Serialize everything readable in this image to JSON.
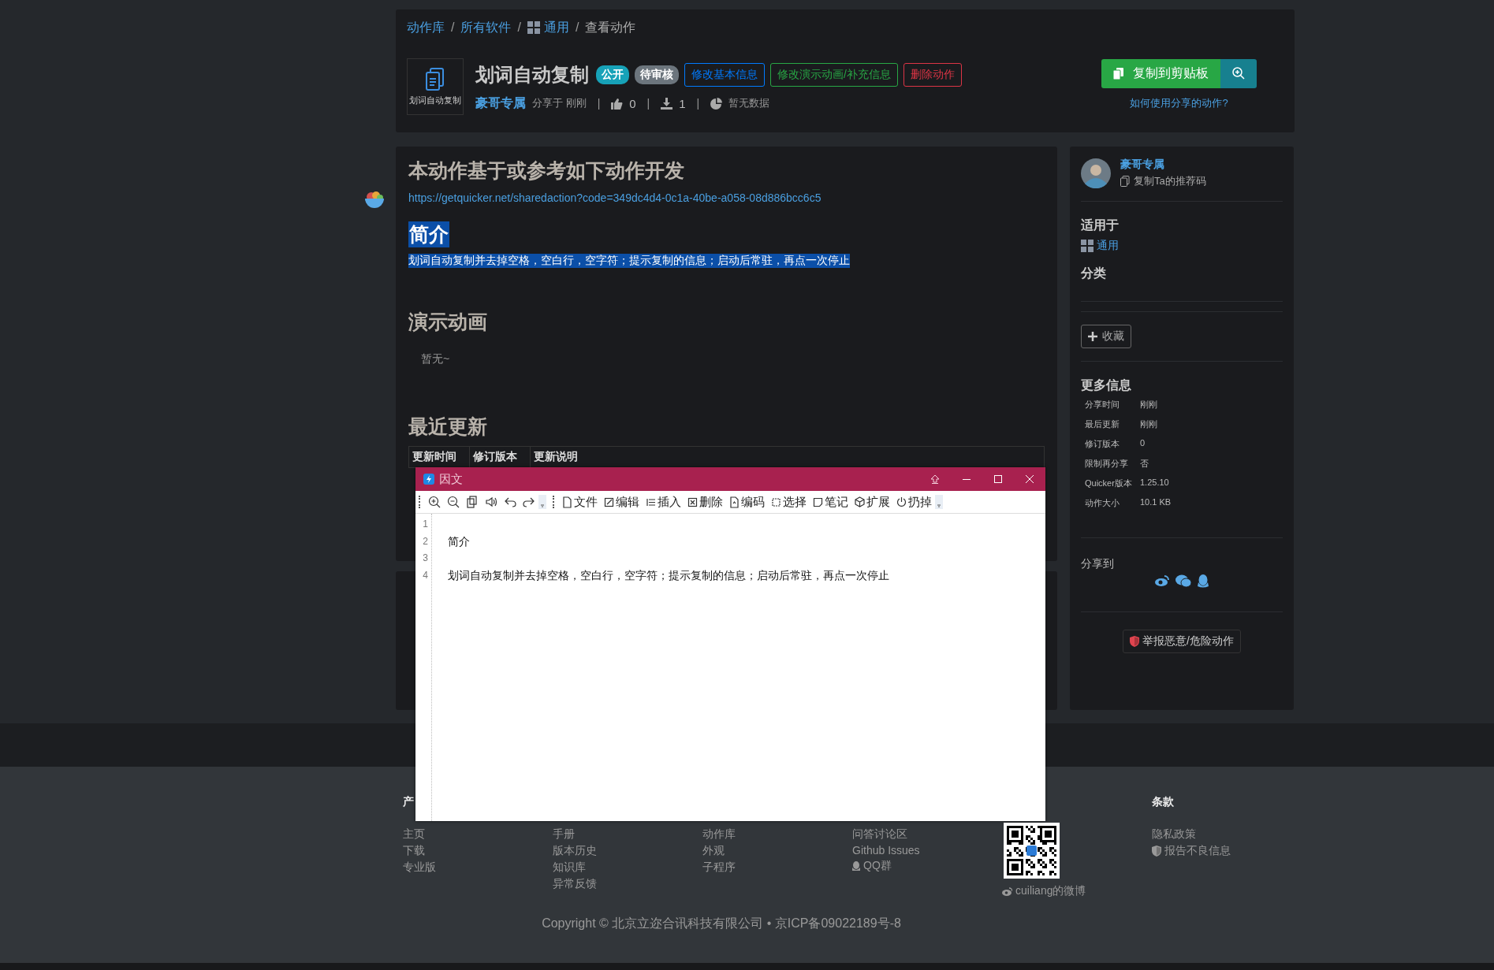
{
  "breadcrumb": [
    {
      "label": "动作库",
      "kind": "link"
    },
    {
      "label": "/",
      "kind": "separator"
    },
    {
      "label": "所有软件",
      "kind": "link"
    },
    {
      "label": "/",
      "kind": "separator"
    },
    {
      "label": "通用",
      "kind": "app"
    },
    {
      "label": "/",
      "kind": "separator"
    },
    {
      "label": "查看动作",
      "kind": "current"
    }
  ],
  "header": {
    "icon_caption": "划词自动复制",
    "title": "划词自动复制",
    "badges": [
      {
        "label": "公开",
        "color": "#17a2b8"
      },
      {
        "label": "待审核",
        "color": "#6c757d"
      }
    ],
    "actions": [
      {
        "label": "修改基本信息",
        "color": "#007bff"
      },
      {
        "label": "修改演示动画/补充信息",
        "color": "#28a745"
      },
      {
        "label": "删除动作",
        "color": "#dc3545"
      }
    ],
    "author": "豪哥专属",
    "shared": "分享于 刚刚",
    "dividers": [
      "|",
      "|",
      "|"
    ],
    "likes": "0",
    "downloads": "1",
    "stats": "暂无数据",
    "copy_button": "复制到剪贴板",
    "help_link": "如何使用分享的动作?"
  },
  "main": {
    "based_on": {
      "heading": "本动作基于或参考如下动作开发",
      "url": "https://getquicker.net/sharedaction?code=349dc4d4-0c1a-40be-a058-08d886bcc6c5"
    },
    "intro": {
      "heading": "简介",
      "text": "划词自动复制并去掉空格，空白行，空字符；提示复制的信息；启动后常驻，再点一次停止",
      "selected": true
    },
    "demo": {
      "heading": "演示动画",
      "empty": "暂无~"
    },
    "updates": {
      "heading": "最近更新",
      "columns": [
        "更新时间",
        "修订版本",
        "更新说明"
      ]
    }
  },
  "sidebar": {
    "user": {
      "name": "豪哥专属",
      "action": "复制Ta的推荐码"
    },
    "applies_to": {
      "heading": "适用于",
      "app": "通用"
    },
    "category": {
      "heading": "分类"
    },
    "favorite_button": "收藏",
    "more_info": {
      "heading": "更多信息",
      "rows": [
        {
          "label": "分享时间",
          "value": "刚刚"
        },
        {
          "label": "最后更新",
          "value": "刚刚"
        },
        {
          "label": "修订版本",
          "value": "0"
        },
        {
          "label": "限制再分享",
          "value": "否"
        },
        {
          "label": "Quicker版本",
          "value": "1.25.10"
        },
        {
          "label": "动作大小",
          "value": "10.1 KB"
        }
      ]
    },
    "share": {
      "heading": "分享到"
    },
    "report_button": "举报恶意/危险动作"
  },
  "editor": {
    "title": "因文",
    "menus": [
      "文件",
      "编辑",
      "插入",
      "删除",
      "编码",
      "选择",
      "笔记",
      "扩展",
      "扔掉"
    ],
    "lines": [
      {
        "number": "1"
      },
      {
        "number": "2",
        "text": "简介"
      },
      {
        "number": "3"
      },
      {
        "number": "4",
        "text": "划词自动复制并去掉空格，空白行，空字符；提示复制的信息；启动后常驻，再点一次停止"
      }
    ]
  },
  "footer": {
    "columns": [
      {
        "heading": "产",
        "links": [
          {
            "label": "主页"
          },
          {
            "label": "下载"
          },
          {
            "label": "专业版"
          }
        ]
      },
      {
        "links": [
          {
            "label": "手册"
          },
          {
            "label": "版本历史"
          },
          {
            "label": "知识库"
          },
          {
            "label": "异常反馈"
          }
        ]
      },
      {
        "links": [
          {
            "label": "动作库"
          },
          {
            "label": "外观"
          },
          {
            "label": "子程序"
          }
        ]
      },
      {
        "links": [
          {
            "label": "问答讨论区"
          },
          {
            "label": "Github Issues"
          },
          {
            "label": "QQ群",
            "kind": "qq"
          }
        ]
      },
      {
        "kind": "qr",
        "caption": "cuiliang的微博"
      },
      {
        "heading": "条款",
        "links": [
          {
            "label": "隐私政策"
          },
          {
            "label": "报告不良信息",
            "kind": "shield"
          }
        ]
      }
    ],
    "copyright": "Copyright © 北京立迩合讯科技有限公司 • 京ICP备09022189号-8"
  }
}
